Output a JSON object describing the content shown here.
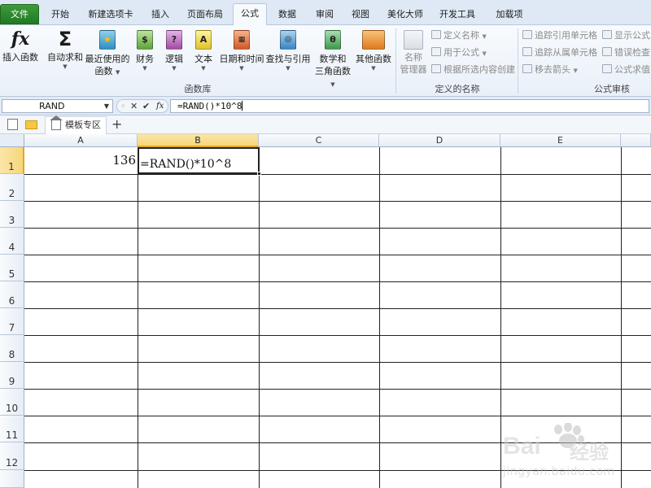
{
  "ribbon_tabs": [
    {
      "label": "文件"
    },
    {
      "label": "开始"
    },
    {
      "label": "新建选项卡"
    },
    {
      "label": "插入"
    },
    {
      "label": "页面布局"
    },
    {
      "label": "公式"
    },
    {
      "label": "数据"
    },
    {
      "label": "审阅"
    },
    {
      "label": "视图"
    },
    {
      "label": "美化大师"
    },
    {
      "label": "开发工具"
    },
    {
      "label": "加载项"
    }
  ],
  "function_library": {
    "group_label": "函数库",
    "insert_function": "插入函数",
    "autosum": "自动求和",
    "recent_1": "最近使用的",
    "recent_2": "函数",
    "financial": "财务",
    "logical": "逻辑",
    "text": "文本",
    "datetime": "日期和时间",
    "lookup": "查找与引用",
    "math_1": "数学和",
    "math_2": "三角函数",
    "more": "其他函数"
  },
  "defined_names": {
    "group_label": "定义的名称",
    "name_manager_1": "名称",
    "name_manager_2": "管理器",
    "define_name": "定义名称",
    "use_in_formula": "用于公式",
    "create_from_selection": "根据所选内容创建"
  },
  "formula_auditing": {
    "group_label": "公式审核",
    "trace_precedents": "追踪引用单元格",
    "trace_dependents": "追踪从属单元格",
    "remove_arrows": "移去箭头",
    "show_formulas": "显示公式",
    "error_checking": "错误检查",
    "evaluate_formula": "公式求值"
  },
  "formula_bar": {
    "name_box": "RAND",
    "formula": "=RAND()*10^8"
  },
  "doc_tabs": {
    "template_tab": "模板专区",
    "new_tab": "+"
  },
  "columns": [
    "A",
    "B",
    "C",
    "D",
    "E"
  ],
  "rows": [
    "1",
    "2",
    "3",
    "4",
    "5",
    "6",
    "7",
    "8",
    "9",
    "10",
    "11",
    "12"
  ],
  "cells": {
    "A1": "136",
    "B1": "=RAND()*10^8"
  },
  "watermark": {
    "brand": "Bai",
    "brand_cn": "经验",
    "url": "jingyan.baidu.com"
  },
  "colors": {
    "file_tab": "#2e8b2e",
    "selection_header": "#f7d67a",
    "ribbon_bg": "#e9f0f8"
  }
}
